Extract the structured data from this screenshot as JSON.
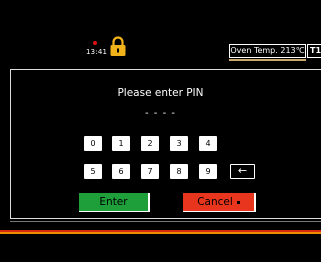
{
  "status_bar": {
    "time": "13:41",
    "lock_icon": "padlock-icon",
    "alarm_color": "#dd1111",
    "oven_temp_label": "Oven Temp. 213℃",
    "tab_label": "T1"
  },
  "dialog": {
    "title": "Please enter PIN",
    "pin_value": "- - - -",
    "keys_row1": [
      "0",
      "1",
      "2",
      "3",
      "4"
    ],
    "keys_row2": [
      "5",
      "6",
      "7",
      "8",
      "9"
    ],
    "backspace_label": "←",
    "enter_label": "Enter",
    "cancel_label": "Cancel",
    "enter_color": "#1e9f3a",
    "cancel_color": "#e8351d"
  },
  "footer": {
    "stripe_colors": [
      "#d42a12",
      "#f08a00"
    ]
  }
}
